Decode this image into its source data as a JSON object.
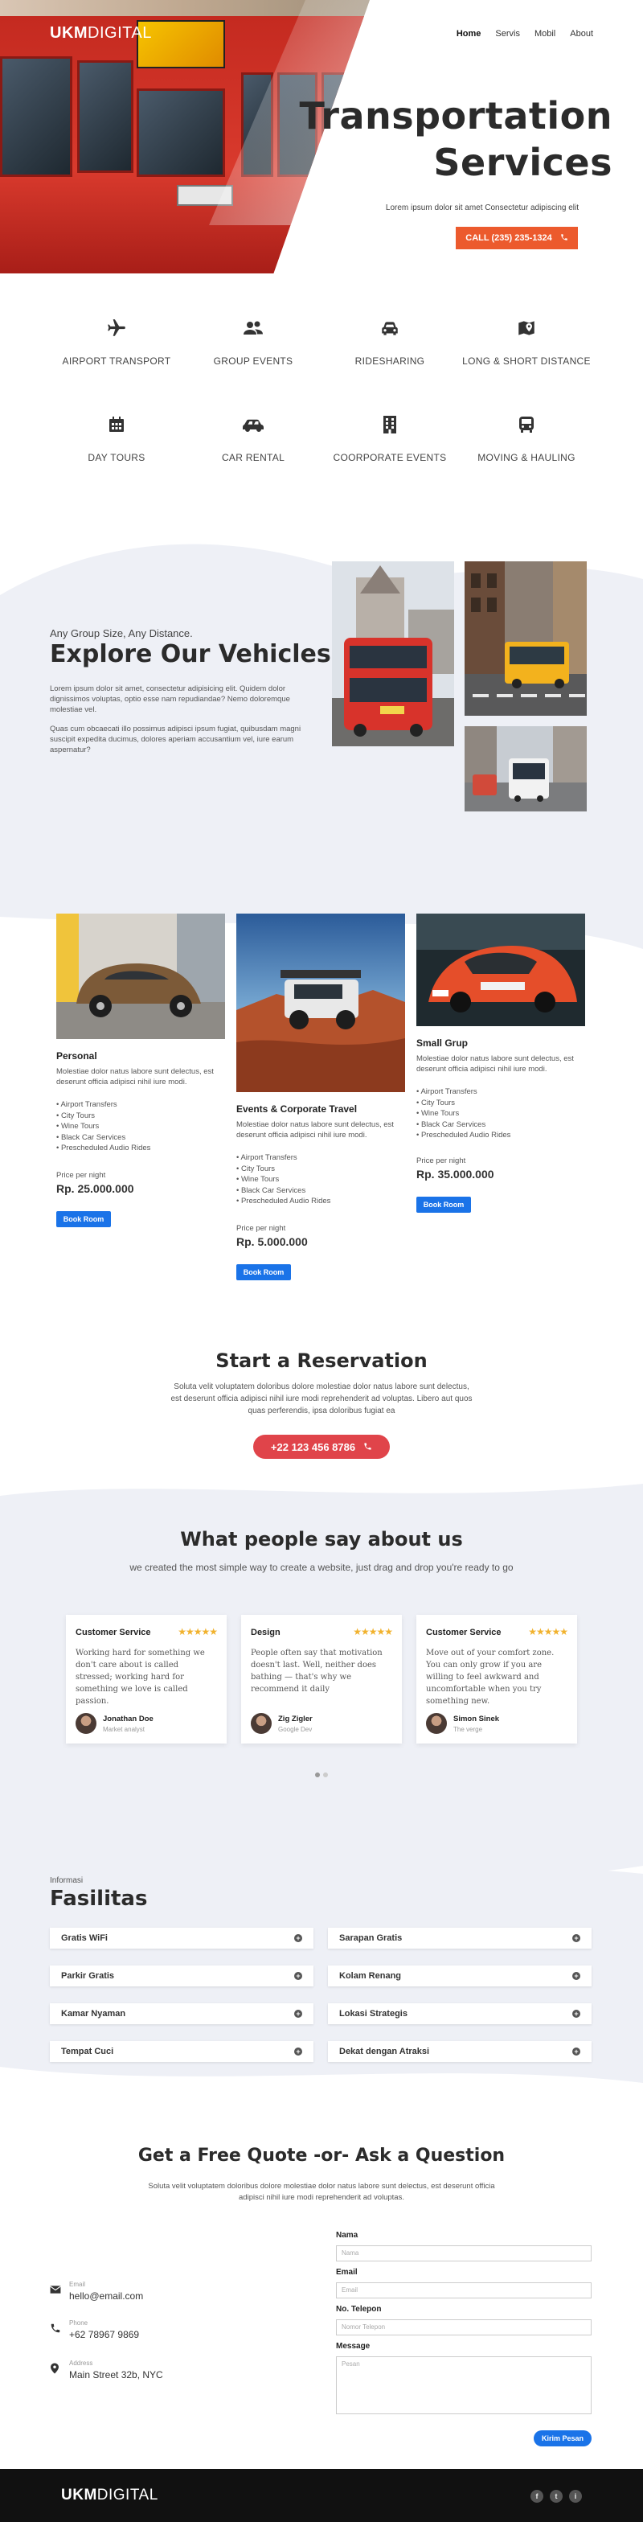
{
  "header": {
    "logo_bold": "UKM",
    "logo_light": "DIGITAL",
    "nav": [
      "Home",
      "Servis",
      "Mobil",
      "About"
    ]
  },
  "hero": {
    "title_line1": "Transportation",
    "title_line2": "Services",
    "subtitle": "Lorem ipsum dolor sit amet Consectetur adipiscing elit",
    "call_label": "CALL (235) 235-1324"
  },
  "services": [
    {
      "label": "AIRPORT TRANSPORT",
      "icon": "airplane-icon"
    },
    {
      "label": "GROUP EVENTS",
      "icon": "users-icon"
    },
    {
      "label": "RIDESHARING",
      "icon": "car-front-icon"
    },
    {
      "label": "LONG & SHORT DISTANCE",
      "icon": "map-marker-icon"
    },
    {
      "label": "DAY TOURS",
      "icon": "calendar-icon"
    },
    {
      "label": "CAR RENTAL",
      "icon": "car-side-icon"
    },
    {
      "label": "COORPORATE EVENTS",
      "icon": "building-icon"
    },
    {
      "label": "MOVING & HAULING",
      "icon": "bus-icon"
    }
  ],
  "explore": {
    "eyebrow": "Any Group Size, Any Distance.",
    "title": "Explore Our Vehicles",
    "p1": "Lorem ipsum dolor sit amet, consectetur adipisicing elit. Quidem dolor dignissimos voluptas, optio esse nam repudiandae? Nemo doloremque molestiae vel.",
    "p2": "Quas cum obcaecati illo possimus adipisci ipsum fugiat, quibusdam magni suscipit expedita ducimus, dolores aperiam accusantium vel, iure earum aspernatur?"
  },
  "cards": [
    {
      "title": "Personal",
      "desc": "Molestiae dolor natus labore sunt delectus, est deserunt officia adipisci nihil iure modi.",
      "features": [
        "Airport Transfers",
        "City Tours",
        "Wine Tours",
        "Black Car Services",
        "Prescheduled Audio Rides"
      ],
      "price_label": "Price per night",
      "price": "Rp. 25.000.000",
      "button": "Book Room"
    },
    {
      "title": "Events & Corporate Travel",
      "desc": "Molestiae dolor natus labore sunt delectus, est deserunt officia adipisci nihil iure modi.",
      "features": [
        "Airport Transfers",
        "City Tours",
        "Wine Tours",
        "Black Car Services",
        "Prescheduled Audio Rides"
      ],
      "price_label": "Price per night",
      "price": "Rp. 5.000.000",
      "button": "Book Room"
    },
    {
      "title": "Small Grup",
      "desc": "Molestiae dolor natus labore sunt delectus, est deserunt officia adipisci nihil iure modi.",
      "features": [
        "Airport Transfers",
        "City Tours",
        "Wine Tours",
        "Black Car Services",
        "Prescheduled Audio Rides"
      ],
      "price_label": "Price per night",
      "price": "Rp. 35.000.000",
      "button": "Book Room"
    }
  ],
  "reservation": {
    "title": "Start a Reservation",
    "text": "Soluta velit voluptatem doloribus dolore molestiae dolor natus labore sunt delectus, est deserunt officia adipisci nihil iure modi reprehenderit ad voluptas. Libero aut quos quas perferendis, ipsa doloribus fugiat ea",
    "phone": "+22 123 456 8786"
  },
  "testimonials": {
    "title": "What people say about us",
    "subtitle": "we created the most simple way to create a website, just drag and drop you're ready to go",
    "items": [
      {
        "heading": "Customer Service",
        "stars": "★★★★★",
        "quote": "Working hard for something we don't care about is called stressed; working hard for something we love is called passion.",
        "name": "Jonathan Doe",
        "role": "Market analyst"
      },
      {
        "heading": "Design",
        "stars": "★★★★★",
        "quote": "People often say that motivation doesn't last. Well, neither does bathing — that's why we recommend it daily",
        "name": "Zig Zigler",
        "role": "Google Dev"
      },
      {
        "heading": "Customer Service",
        "stars": "★★★★★",
        "quote": "Move out of your comfort zone. You can only grow if you are willing to feel awkward and uncomfortable when you try something new.",
        "name": "Simon Sinek",
        "role": "The verge"
      }
    ]
  },
  "facilities": {
    "eyebrow": "Informasi",
    "title": "Fasilitas",
    "items": [
      "Gratis WiFi",
      "Sarapan Gratis",
      "Parkir Gratis",
      "Kolam Renang",
      "Kamar Nyaman",
      "Lokasi Strategis",
      "Tempat Cuci",
      "Dekat dengan Atraksi"
    ]
  },
  "contact": {
    "title": "Get a Free Quote -or- Ask a Question",
    "text": "Soluta velit voluptatem doloribus dolore molestiae dolor natus labore sunt delectus, est deserunt officia adipisci nihil iure modi reprehenderit ad voluptas.",
    "info": [
      {
        "label": "Email",
        "value": "hello@email.com"
      },
      {
        "label": "Phone",
        "value": "+62 78967 9869"
      },
      {
        "label": "Address",
        "value": "Main Street 32b, NYC"
      }
    ],
    "form": {
      "name_label": "Nama",
      "name_placeholder": "Nama",
      "email_label": "Email",
      "email_placeholder": "Email",
      "phone_label": "No. Telepon",
      "phone_placeholder": "Nomor Telepon",
      "message_label": "Message",
      "message_placeholder": "Pesan",
      "submit": "Kirim Pesan"
    }
  },
  "footer": {
    "logo_bold": "UKM",
    "logo_light": "DIGITAL",
    "social": [
      "f",
      "t",
      "i"
    ]
  },
  "colors": {
    "accent_orange": "#ec5a2d",
    "accent_red": "#e0444a",
    "primary_blue": "#1a73e8",
    "light_bg": "#eef0f6"
  }
}
